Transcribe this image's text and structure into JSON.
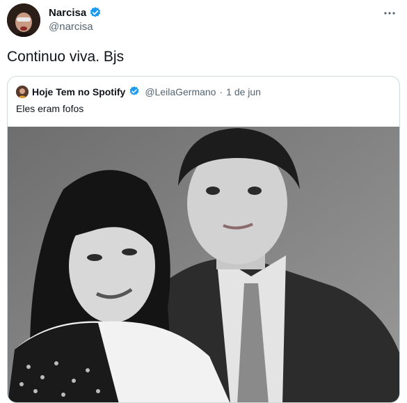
{
  "tweet": {
    "author_name": "Narcisa",
    "author_handle": "@narcisa",
    "text": "Continuo viva. Bjs",
    "more_icon": "more-icon"
  },
  "quote": {
    "author_name": "Hoje Tem no Spotify",
    "author_handle": "@LeilaGermano",
    "separator": "·",
    "date": "1 de jun",
    "text": "Eles eram fofos"
  },
  "colors": {
    "verified": "#1d9bf0",
    "secondary_text": "#536471",
    "border": "#cfd9de"
  }
}
